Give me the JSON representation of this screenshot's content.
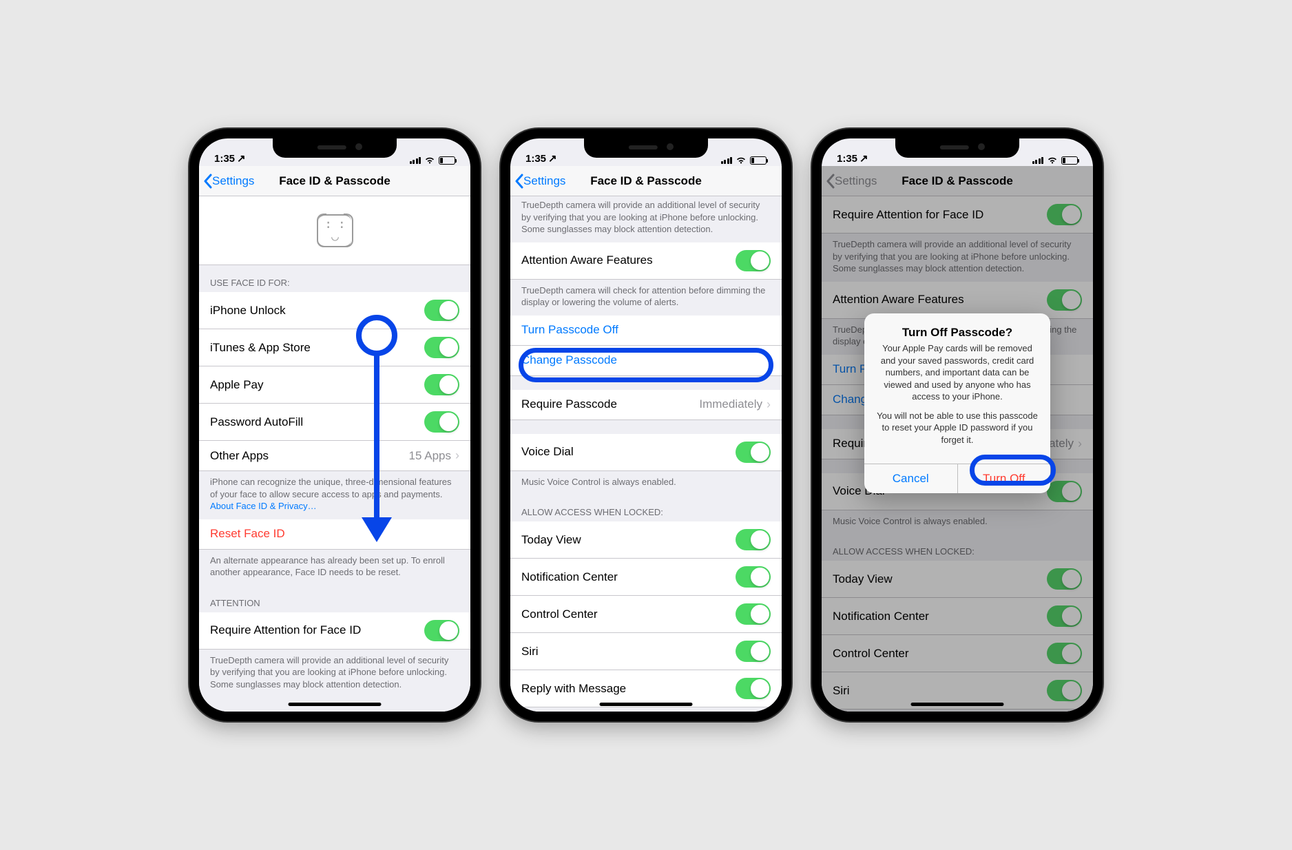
{
  "status": {
    "time": "1:35",
    "loc_arrow": "↗"
  },
  "nav": {
    "back": "Settings",
    "title": "Face ID & Passcode"
  },
  "s1": {
    "header": "USE FACE ID FOR:",
    "iphone_unlock": "iPhone Unlock",
    "itunes": "iTunes & App Store",
    "apple_pay": "Apple Pay",
    "autofill": "Password AutoFill",
    "other_apps": "Other Apps",
    "other_apps_val": "15 Apps",
    "footer1": "iPhone can recognize the unique, three-dimensional features of your face to allow secure access to apps and payments. ",
    "footer1_link": "About Face ID & Privacy…",
    "reset": "Reset Face ID",
    "reset_footer": "An alternate appearance has already been set up. To enroll another appearance, Face ID needs to be reset.",
    "attention_hdr": "ATTENTION",
    "req_attention": "Require Attention for Face ID",
    "req_attention_footer": "TrueDepth camera will provide an additional level of security by verifying that you are looking at iPhone before unlocking. Some sunglasses may block attention detection."
  },
  "s2": {
    "truedepth_frag": "TrueDepth camera will provide an additional level of security by verifying that you are looking at iPhone before unlocking. Some sunglasses may block attention detection.",
    "aware": "Attention Aware Features",
    "aware_footer": "TrueDepth camera will check for attention before dimming the display or lowering the volume of alerts.",
    "turn_off": "Turn Passcode Off",
    "change": "Change Passcode",
    "require": "Require Passcode",
    "require_val": "Immediately",
    "voice_dial": "Voice Dial",
    "voice_footer": "Music Voice Control is always enabled.",
    "allow_hdr": "ALLOW ACCESS WHEN LOCKED:",
    "today": "Today View",
    "notif": "Notification Center",
    "cc": "Control Center",
    "siri": "Siri",
    "reply": "Reply with Message"
  },
  "alert": {
    "title": "Turn Off Passcode?",
    "msg1": "Your Apple Pay cards will be removed and your saved passwords, credit card numbers, and important data can be viewed and used by anyone who has access to your iPhone.",
    "msg2": "You will not be able to use this passcode to reset your Apple ID password if you forget it.",
    "cancel": "Cancel",
    "turnoff": "Turn Off"
  }
}
